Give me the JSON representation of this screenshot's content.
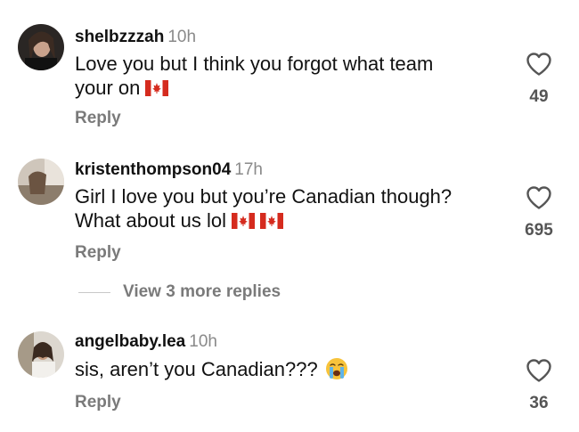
{
  "comments": [
    {
      "username": "shelbzzzah",
      "time": "10h",
      "text_line1": "Love you but I think you forgot what team",
      "text_line2": "your on",
      "emoji": [
        "flag-canada"
      ],
      "reply_label": "Reply",
      "likes": "49"
    },
    {
      "username": "kristenthompson04",
      "time": "17h",
      "text_line1": "Girl I love you but you’re Canadian though?",
      "text_line2": "What about us lol",
      "emoji": [
        "flag-canada",
        "flag-canada"
      ],
      "reply_label": "Reply",
      "likes": "695"
    },
    {
      "username": "angelbaby.lea",
      "time": "10h",
      "text_line1": "sis, aren’t you Canadian???",
      "emoji": [
        "loudly-crying-face"
      ],
      "reply_label": "Reply",
      "likes": "36"
    }
  ],
  "view_more_replies": "View 3 more replies",
  "colors": {
    "text": "#111111",
    "muted": "#8a8a8a",
    "reply": "#7a7a7a",
    "flag_red": "#d52b1e"
  },
  "icons": {
    "like": "heart-outline-icon",
    "flag": "flag-canada-emoji",
    "cry": "loudly-crying-face-emoji"
  }
}
